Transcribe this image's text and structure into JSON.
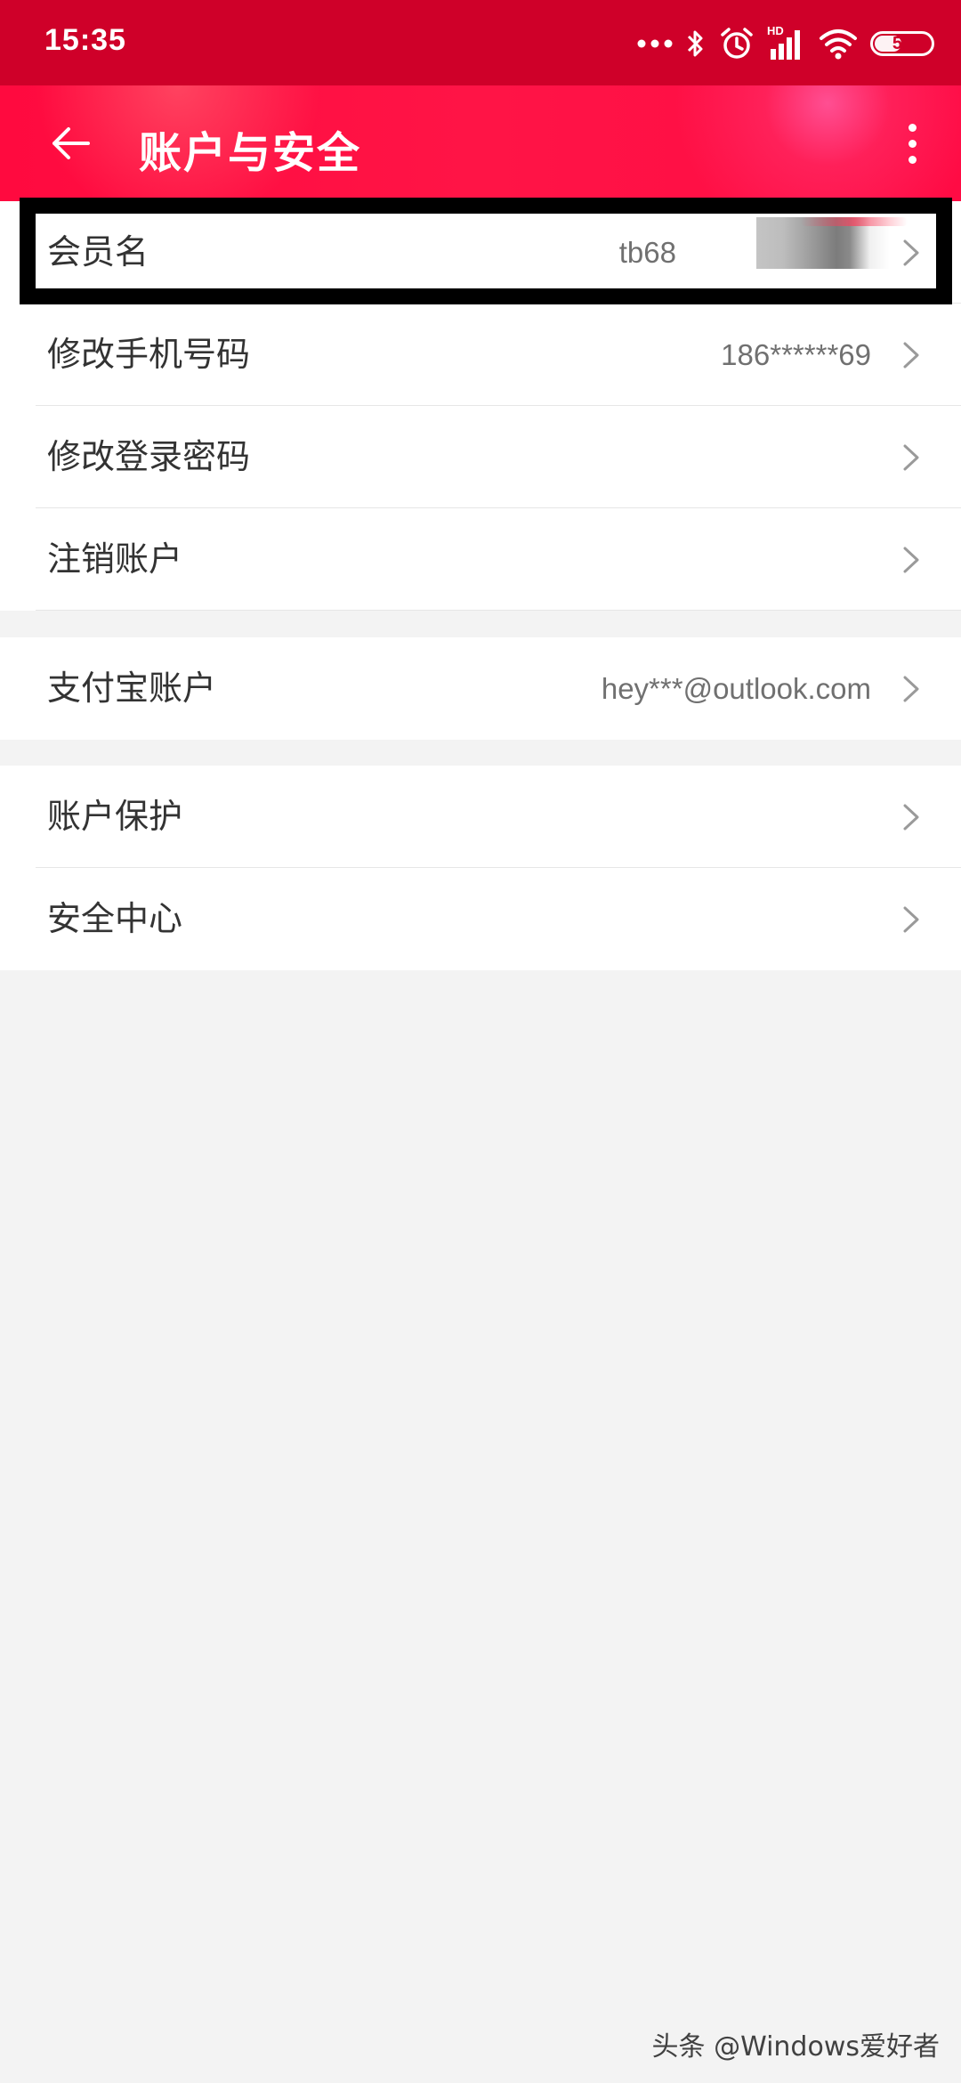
{
  "status_bar": {
    "time": "15:35",
    "network_badge": "HD",
    "battery": "51",
    "battery_level": 0.51,
    "icons": [
      "more-dots-icon",
      "bluetooth-icon",
      "alarm-icon",
      "cellular-signal-icon",
      "wifi-icon",
      "battery-icon"
    ]
  },
  "app_bar": {
    "title": "账户与安全",
    "back_icon": "arrow-left-icon",
    "menu_icon": "more-vertical-icon"
  },
  "sections": [
    {
      "rows": [
        {
          "label": "会员名",
          "value": "tb68"
        },
        {
          "label": "修改手机号码",
          "value": "186******69"
        },
        {
          "label": "修改登录密码",
          "value": ""
        },
        {
          "label": "注销账户",
          "value": ""
        }
      ]
    },
    {
      "rows": [
        {
          "label": "支付宝账户",
          "value": "hey***@outlook.com"
        }
      ]
    },
    {
      "rows": [
        {
          "label": "账户保护",
          "value": ""
        },
        {
          "label": "安全中心",
          "value": ""
        }
      ]
    }
  ],
  "watermark": "头条 @Windows爱好者",
  "colors": {
    "status_bar": "#cf0029",
    "app_bar": "#ff1446",
    "background": "#f3f3f3"
  }
}
